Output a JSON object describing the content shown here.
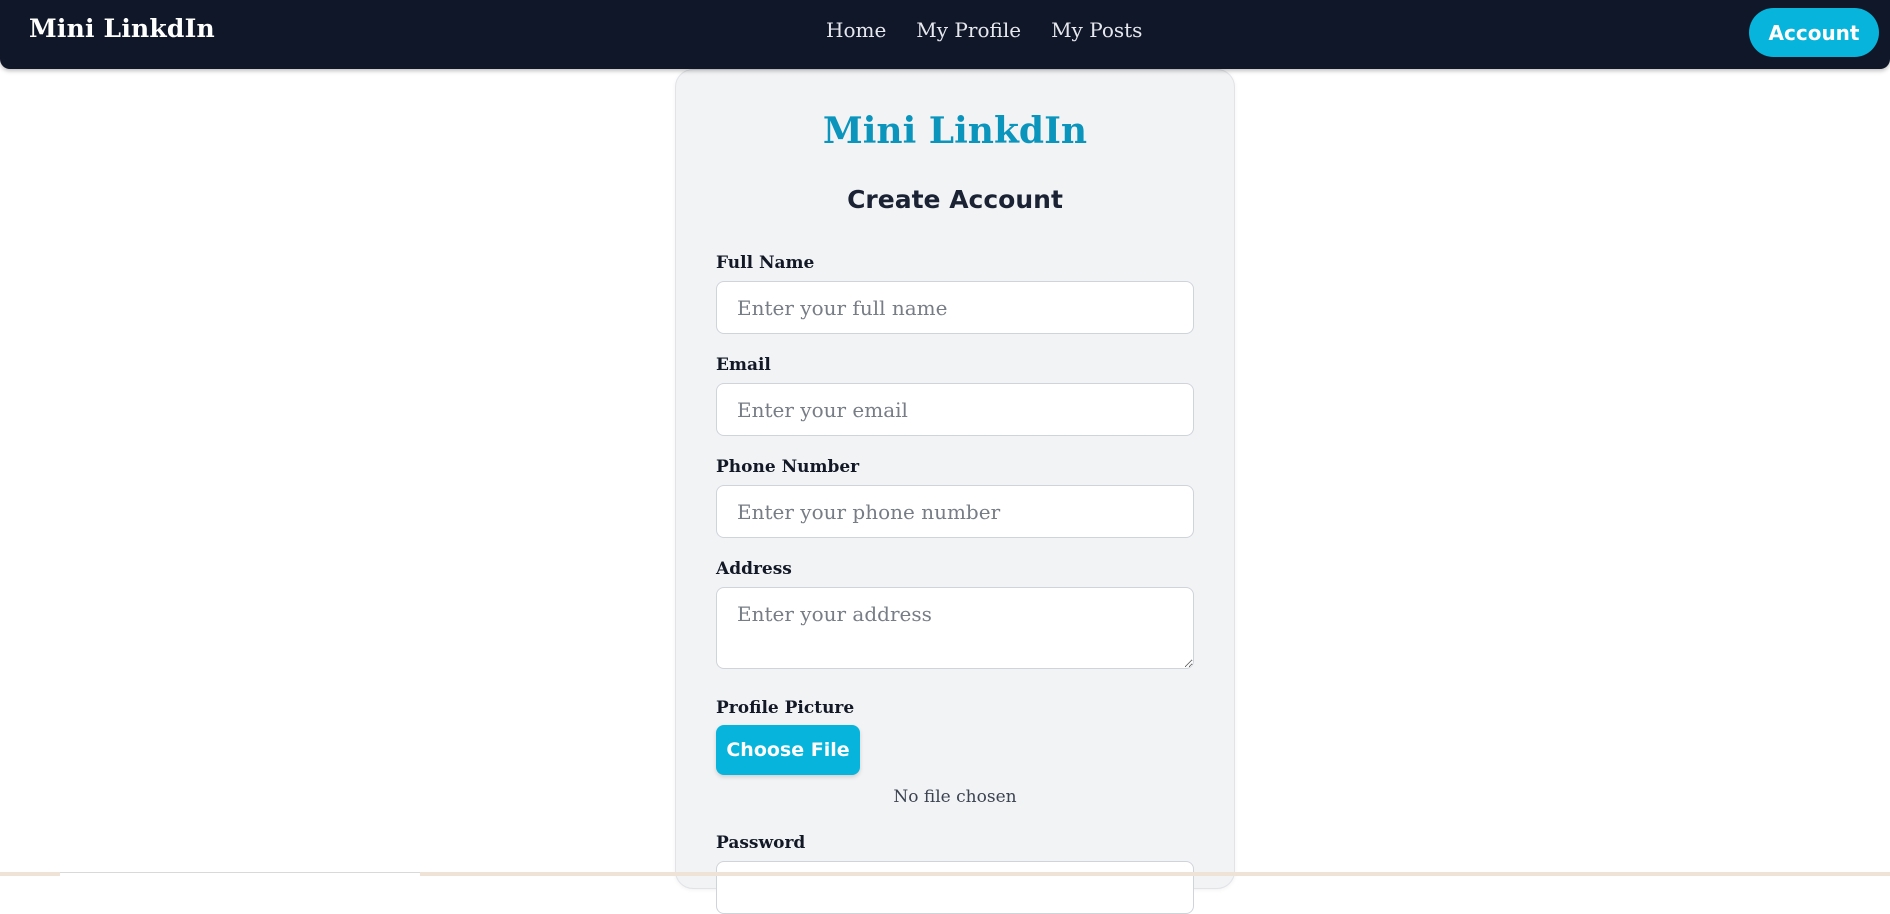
{
  "navbar": {
    "brand": "Mini LinkdIn",
    "links": [
      "Home",
      "My Profile",
      "My Posts"
    ],
    "account_label": "Account"
  },
  "colors": {
    "navbar_bg": "#101729",
    "accent": "#07b4db",
    "logo_text": "#0b95bd",
    "card_bg": "#f2f3f5"
  },
  "form": {
    "logo": "Mini LinkdIn",
    "heading": "Create Account",
    "full_name": {
      "label": "Full Name",
      "placeholder": "Enter your full name",
      "value": ""
    },
    "email": {
      "label": "Email",
      "placeholder": "Enter your email",
      "value": ""
    },
    "phone": {
      "label": "Phone Number",
      "placeholder": "Enter your phone number",
      "value": ""
    },
    "address": {
      "label": "Address",
      "placeholder": "Enter your address",
      "value": ""
    },
    "profile_picture": {
      "label": "Profile Picture",
      "button": "Choose File",
      "status": "No file chosen"
    },
    "password": {
      "label": "Password"
    }
  }
}
